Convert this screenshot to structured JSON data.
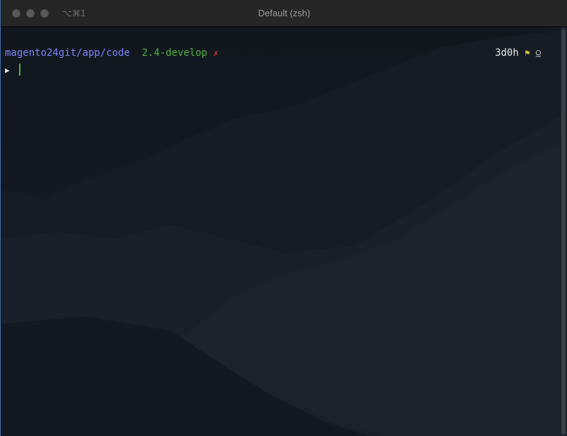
{
  "window": {
    "title": "Default (zsh)",
    "shortcut": "⌥⌘1"
  },
  "prompt": {
    "path": "magento24git/app/code",
    "branch": "2.4-develop",
    "dirty_marker": "✗",
    "symbol": "▶",
    "elapsed": "3d0h",
    "flag_icon": "⚑",
    "status_icon": "⍜"
  },
  "colors": {
    "path": "#7a84ff",
    "branch": "#4fb13e",
    "dirty": "#d23b3b",
    "flag": "#d1c63a",
    "cursor": "#4fb13e"
  }
}
